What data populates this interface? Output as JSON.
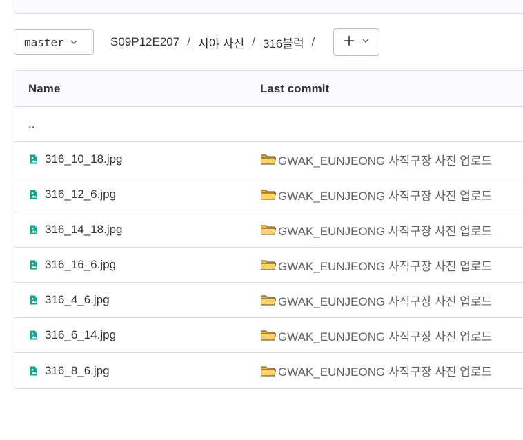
{
  "toolbar": {
    "branch": "master",
    "breadcrumb": [
      "S09P12E207",
      "시야 사진",
      "316블럭"
    ],
    "separator": "/",
    "add_label": "+"
  },
  "table": {
    "headers": {
      "name": "Name",
      "last_commit": "Last commit"
    },
    "parent_dir": "..",
    "rows": [
      {
        "name": "316_10_18.jpg",
        "commit": "GWAK_EUNJEONG 사직구장 사진 업로드"
      },
      {
        "name": "316_12_6.jpg",
        "commit": "GWAK_EUNJEONG 사직구장 사진 업로드"
      },
      {
        "name": "316_14_18.jpg",
        "commit": "GWAK_EUNJEONG 사직구장 사진 업로드"
      },
      {
        "name": "316_16_6.jpg",
        "commit": "GWAK_EUNJEONG 사직구장 사진 업로드"
      },
      {
        "name": "316_4_6.jpg",
        "commit": "GWAK_EUNJEONG 사직구장 사진 업로드"
      },
      {
        "name": "316_6_14.jpg",
        "commit": "GWAK_EUNJEONG 사직구장 사진 업로드"
      },
      {
        "name": "316_8_6.jpg",
        "commit": "GWAK_EUNJEONG 사직구장 사진 업로드"
      }
    ]
  },
  "colors": {
    "image_icon": "#1f9e8f",
    "folder_icon": "#f5b841",
    "border": "#dcdcde"
  },
  "icons": {
    "file": "image-file-icon",
    "commit": "folder-icon",
    "dropdown": "chevron-down-icon"
  }
}
